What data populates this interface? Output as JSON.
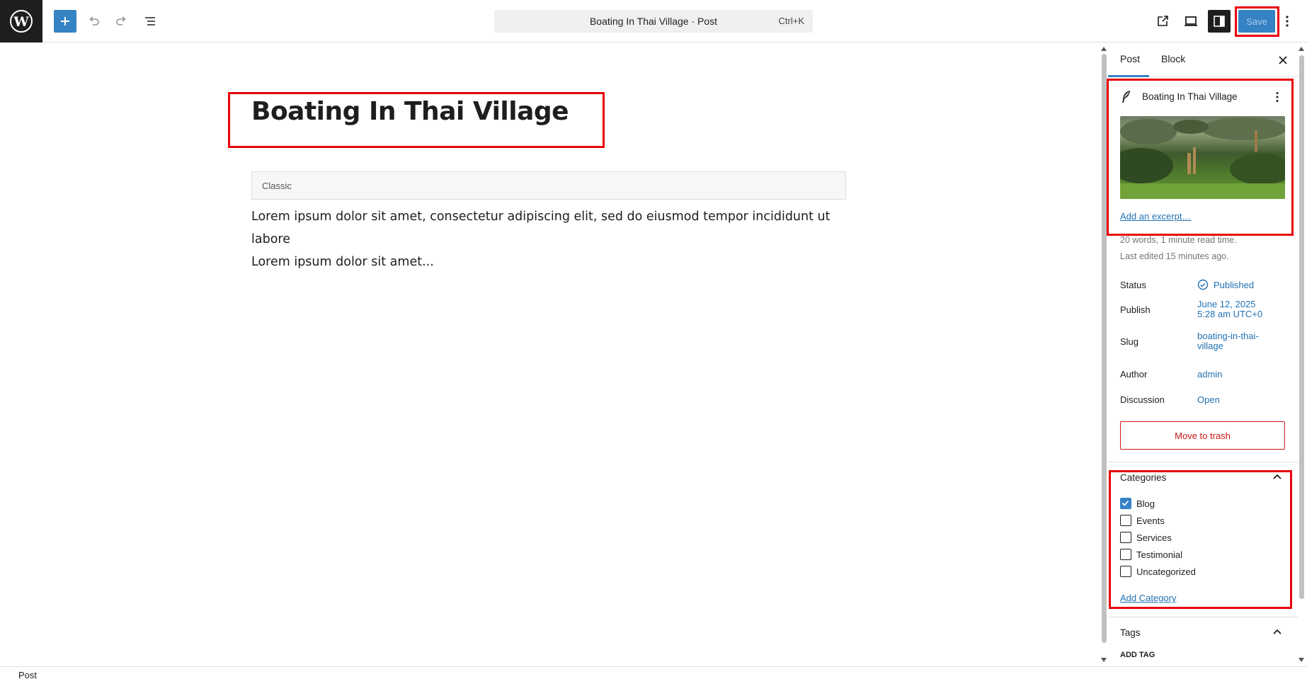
{
  "toolbar": {
    "document_title": "Boating In Thai Village · Post",
    "shortcut": "Ctrl+K",
    "save_label": "Save"
  },
  "editor": {
    "post_title": "Boating In Thai Village",
    "classic_block_label": "Classic",
    "paragraph_line1": "Lorem ipsum dolor sit amet, consectetur adipiscing elit, sed do eiusmod tempor incididunt ut labore",
    "paragraph_line2": "Lorem ipsum dolor sit amet..."
  },
  "sidebar": {
    "tabs": [
      {
        "label": "Post",
        "active": true
      },
      {
        "label": "Block",
        "active": false
      }
    ],
    "post_card": {
      "title": "Boating In Thai Village",
      "excerpt_link": "Add an excerpt…"
    },
    "stats": "20 words, 1 minute read time.",
    "last_edited": "Last edited 15 minutes ago.",
    "fields": {
      "status": {
        "label": "Status",
        "value": "Published"
      },
      "publish": {
        "label": "Publish",
        "value_line1": "June 12, 2025",
        "value_line2": "5:28 am UTC+0"
      },
      "slug": {
        "label": "Slug",
        "value_line1": "boating-in-thai-",
        "value_line2": "village"
      },
      "author": {
        "label": "Author",
        "value": "admin"
      },
      "discussion": {
        "label": "Discussion",
        "value": "Open"
      }
    },
    "trash_label": "Move to trash",
    "categories": {
      "heading": "Categories",
      "items": [
        {
          "label": "Blog",
          "checked": true
        },
        {
          "label": "Events",
          "checked": false
        },
        {
          "label": "Services",
          "checked": false
        },
        {
          "label": "Testimonial",
          "checked": false
        },
        {
          "label": "Uncategorized",
          "checked": false
        }
      ],
      "add_link": "Add Category"
    },
    "tags": {
      "heading": "Tags",
      "add_label": "ADD TAG"
    }
  },
  "statusbar": {
    "breadcrumb": "Post"
  },
  "colors": {
    "accent": "#3582c4",
    "highlight": "#e8000b",
    "danger": "#cc1818",
    "link": "#2271b1"
  }
}
